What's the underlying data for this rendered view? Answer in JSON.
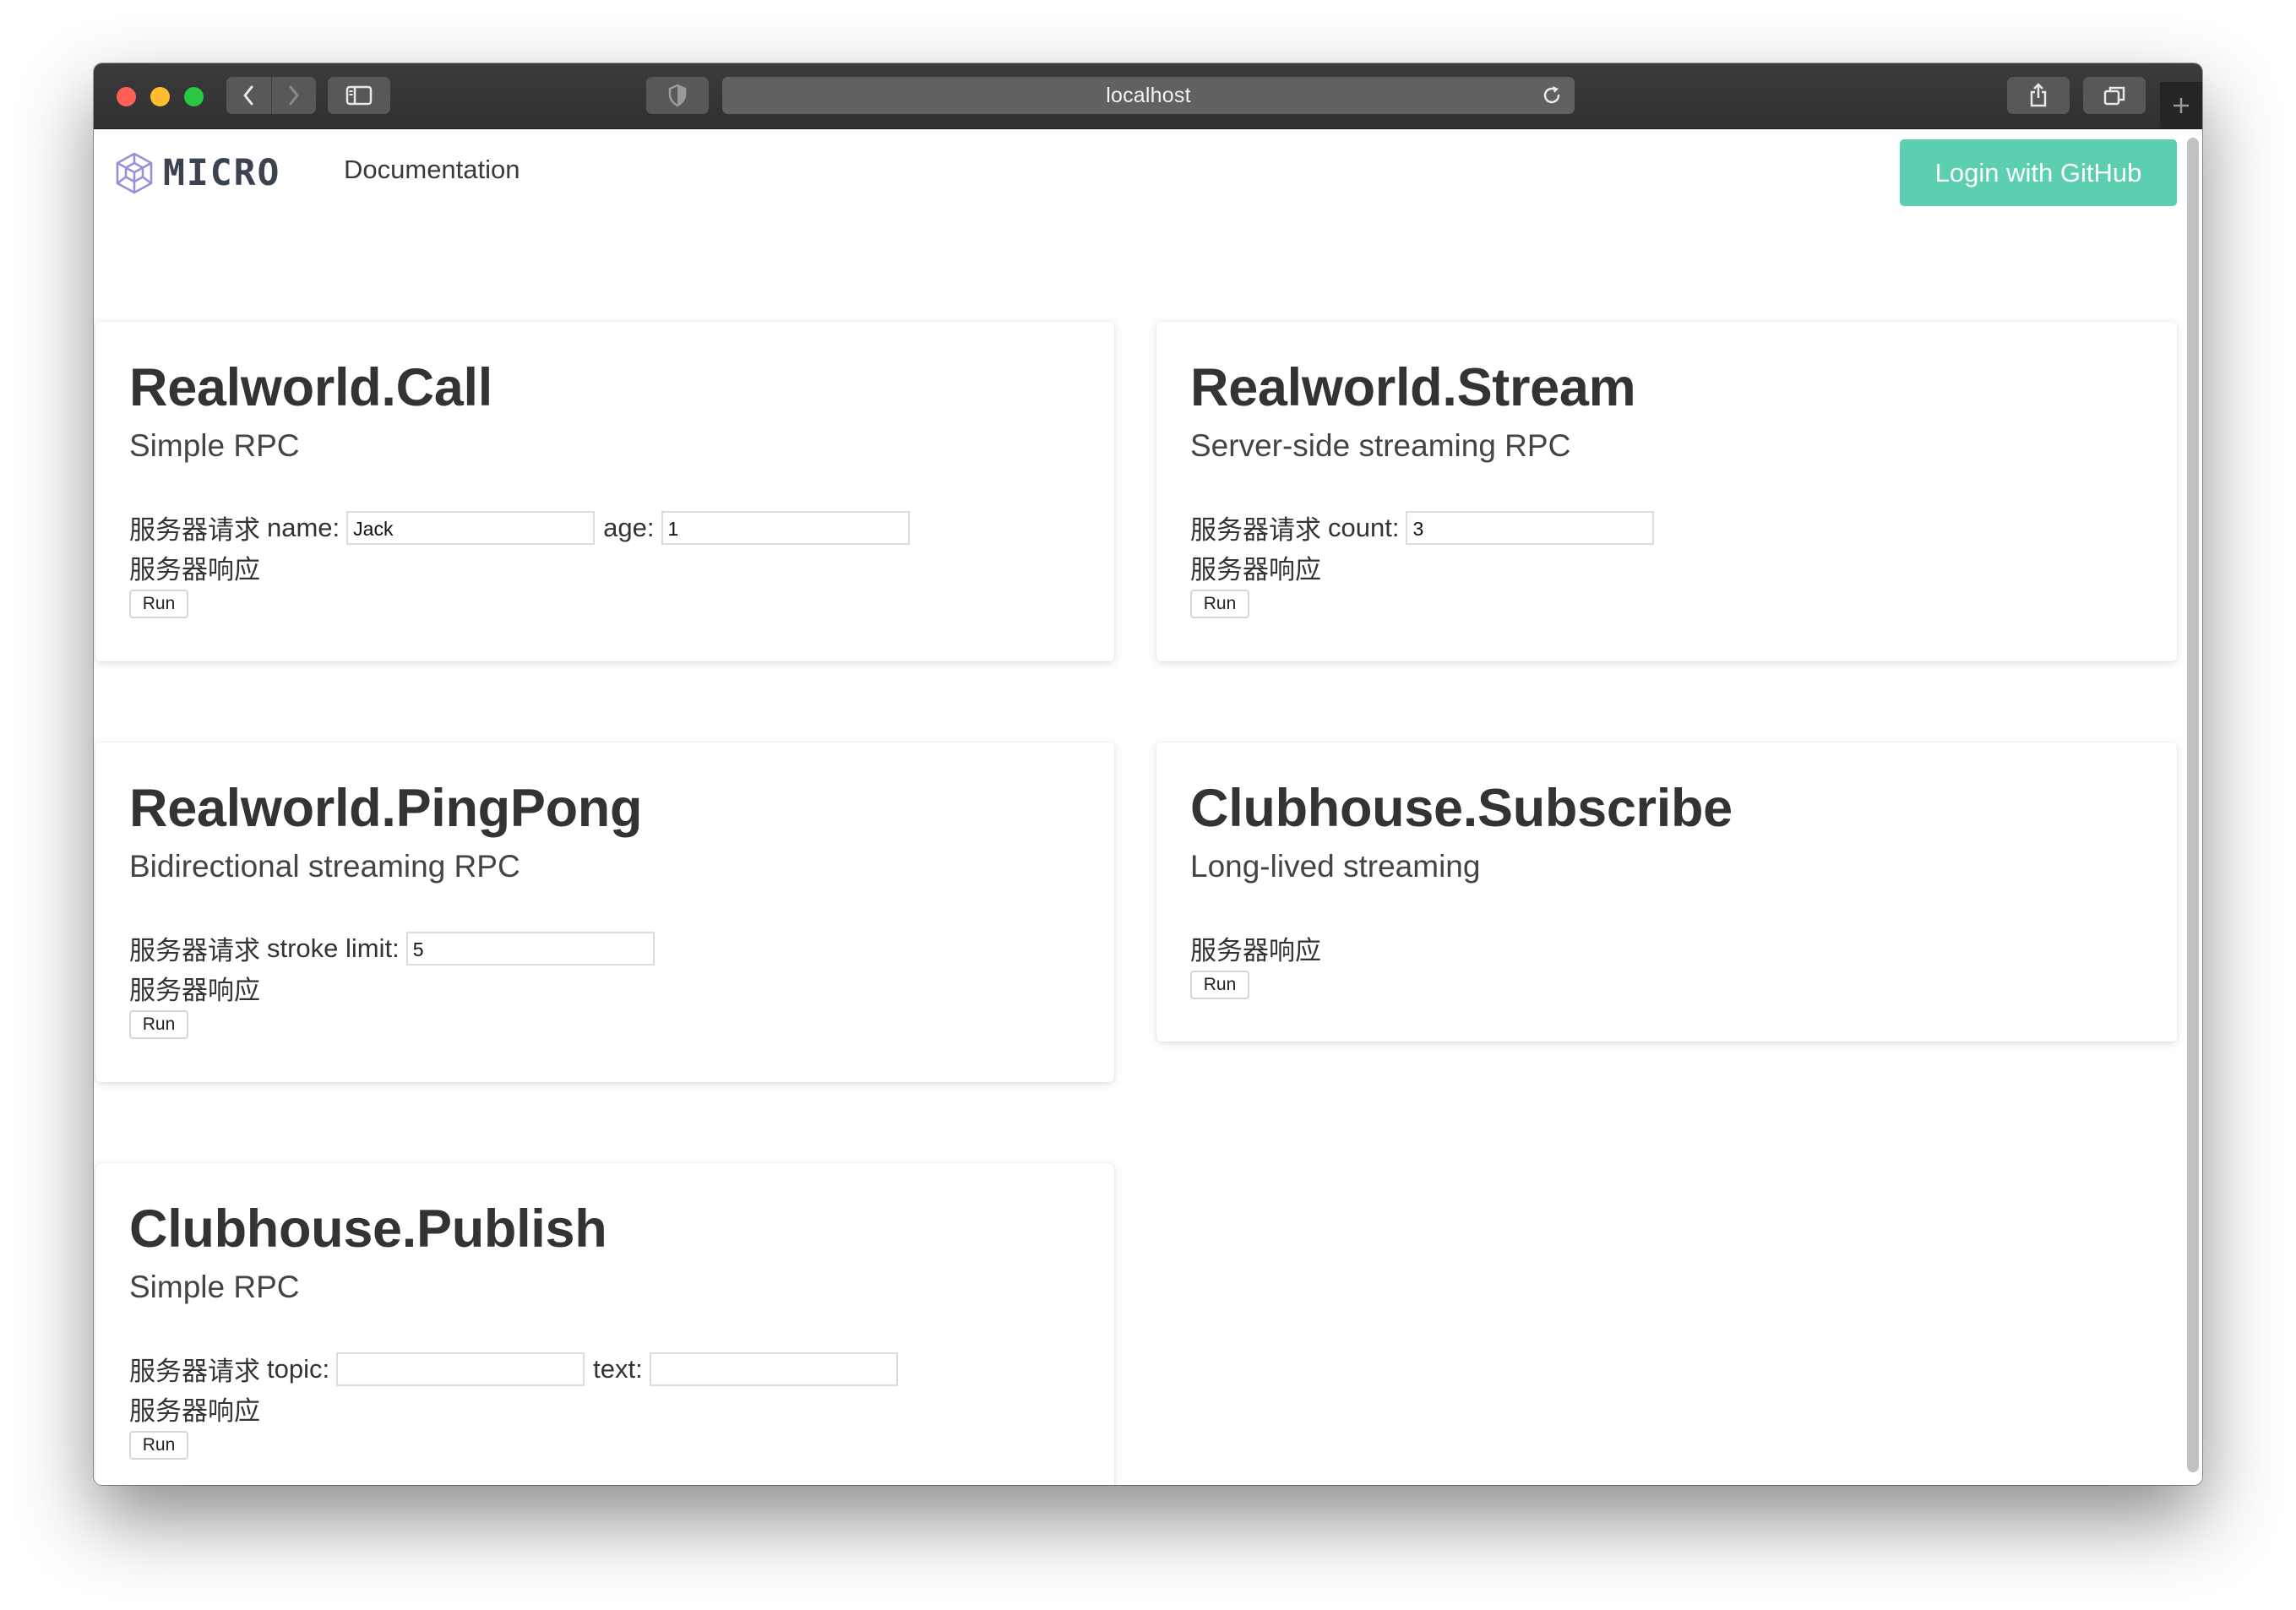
{
  "browser": {
    "url": "localhost",
    "new_tab_symbol": "+"
  },
  "nav": {
    "logo_text": "MICRO",
    "logo_icon": "cube-logo-icon",
    "documentation_label": "Documentation",
    "login_label": "Login with GitHub"
  },
  "colors": {
    "accent": "#5ccfb0",
    "logo_icon": "#9b8fd6",
    "logo_text": "#3c4350"
  },
  "cards": [
    {
      "title": "Realworld.Call",
      "subtitle": "Simple RPC",
      "request_label": "服务器请求",
      "fields": [
        {
          "label": "name:",
          "value": "Jack"
        },
        {
          "label": "age:",
          "value": "1"
        }
      ],
      "response_label": "服务器响应",
      "run_label": "Run"
    },
    {
      "title": "Realworld.Stream",
      "subtitle": "Server-side streaming RPC",
      "request_label": "服务器请求",
      "fields": [
        {
          "label": "count:",
          "value": "3"
        }
      ],
      "response_label": "服务器响应",
      "run_label": "Run"
    },
    {
      "title": "Realworld.PingPong",
      "subtitle": "Bidirectional streaming RPC",
      "request_label": "服务器请求",
      "fields": [
        {
          "label": "stroke limit:",
          "value": "5"
        }
      ],
      "response_label": "服务器响应",
      "run_label": "Run"
    },
    {
      "title": "Clubhouse.Subscribe",
      "subtitle": "Long-lived streaming",
      "response_label": "服务器响应",
      "run_label": "Run"
    },
    {
      "title": "Clubhouse.Publish",
      "subtitle": "Simple RPC",
      "request_label": "服务器请求",
      "fields": [
        {
          "label": "topic:",
          "value": ""
        },
        {
          "label": "text:",
          "value": ""
        }
      ],
      "response_label": "服务器响应",
      "run_label": "Run"
    }
  ]
}
